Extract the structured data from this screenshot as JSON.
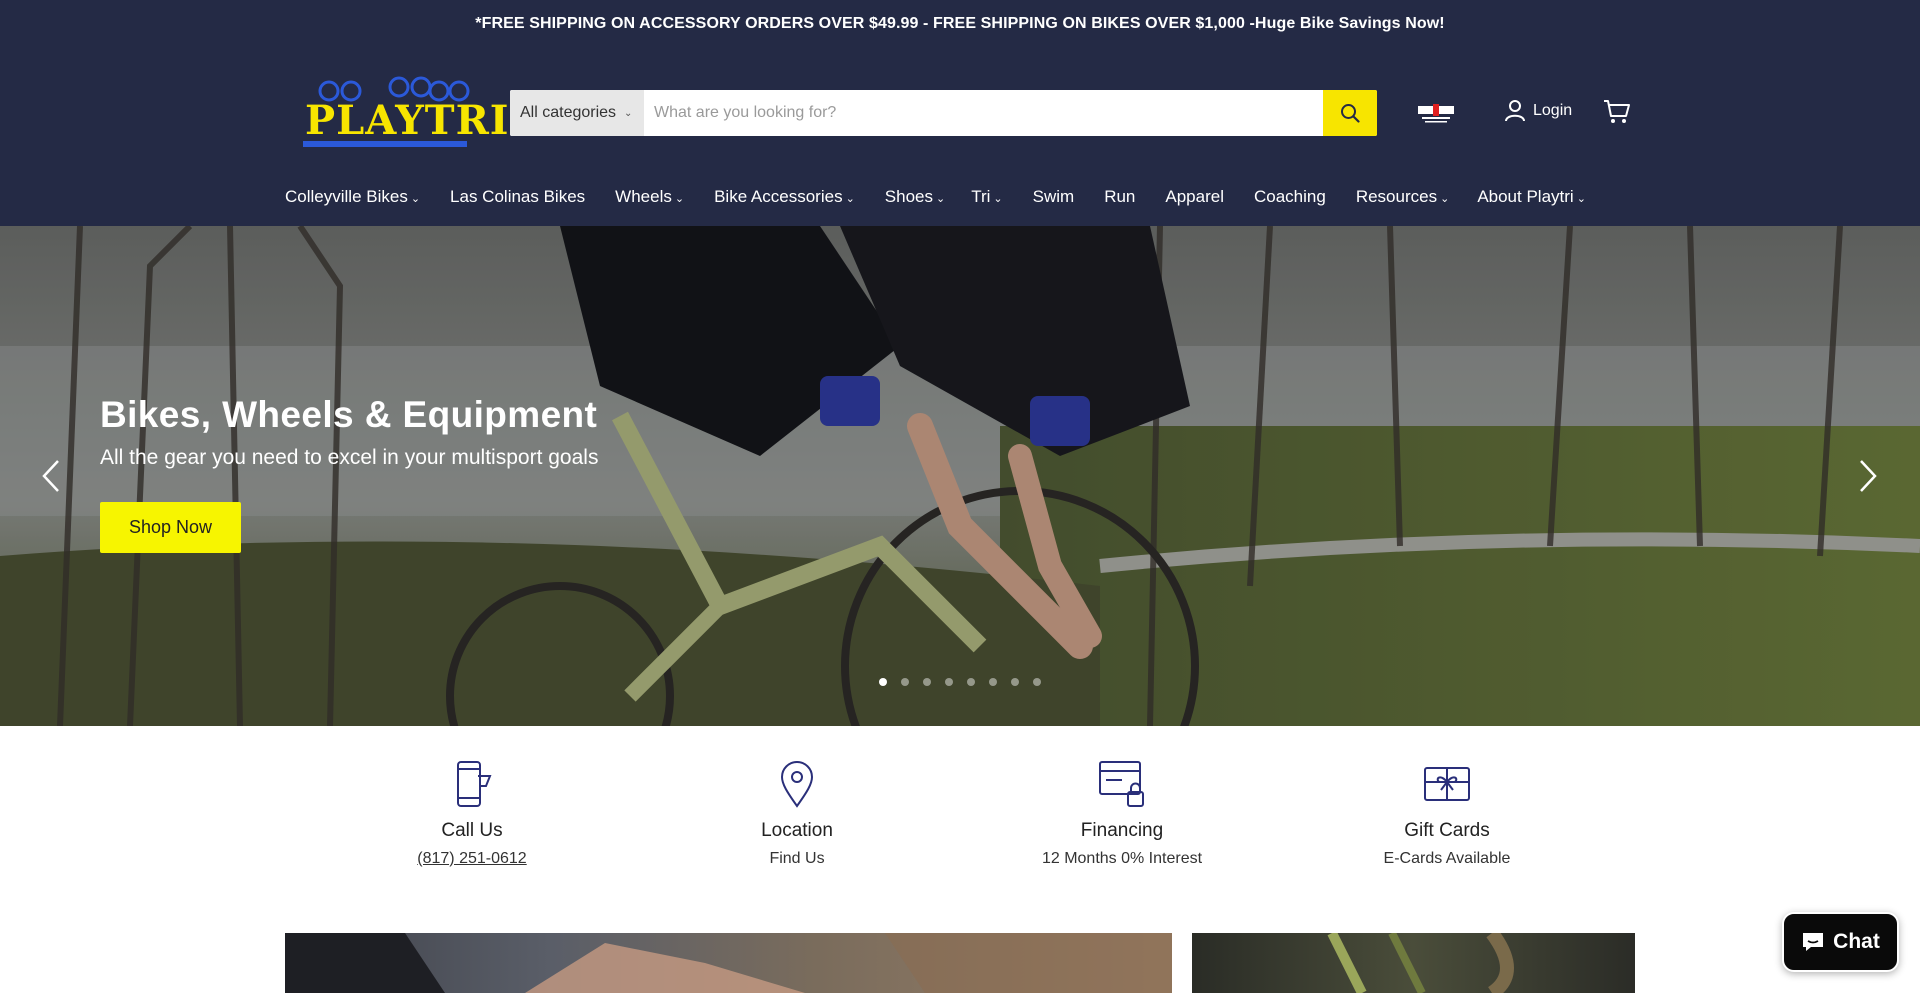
{
  "announcement": "*FREE SHIPPING ON ACCESSORY ORDERS OVER $49.99 - FREE SHIPPING ON BIKES OVER $1,000 -Huge Bike Savings Now!",
  "logo": {
    "text": "PLAYTRI"
  },
  "search": {
    "category": "All categories",
    "placeholder": "What are you looking for?"
  },
  "account": {
    "login_label": "Login"
  },
  "nav": [
    {
      "label": "Colleyville Bikes",
      "dropdown": true
    },
    {
      "label": "Las Colinas Bikes",
      "dropdown": false
    },
    {
      "label": "Wheels",
      "dropdown": true
    },
    {
      "label": "Bike Accessories",
      "dropdown": true
    },
    {
      "label": "Shoes",
      "dropdown": true
    },
    {
      "label": "Tri",
      "dropdown": true
    },
    {
      "label": "Swim",
      "dropdown": false
    },
    {
      "label": "Run",
      "dropdown": false
    },
    {
      "label": "Apparel",
      "dropdown": false
    },
    {
      "label": "Coaching",
      "dropdown": false
    },
    {
      "label": "Resources",
      "dropdown": true
    },
    {
      "label": "About Playtri",
      "dropdown": true
    }
  ],
  "hero": {
    "title": "Bikes, Wheels & Equipment",
    "subtitle": "All the gear you need to excel in your multisport goals",
    "cta": "Shop Now",
    "slide_count": 8,
    "active_slide": 1
  },
  "features": [
    {
      "icon": "phone-icon",
      "title": "Call Us",
      "subtitle": "(817) 251-0612",
      "link": true
    },
    {
      "icon": "location-pin-icon",
      "title": "Location",
      "subtitle": "Find Us",
      "link": false
    },
    {
      "icon": "financing-card-lock-icon",
      "title": "Financing",
      "subtitle": "12 Months 0% Interest",
      "link": false
    },
    {
      "icon": "gift-card-icon",
      "title": "Gift Cards",
      "subtitle": "E-Cards Available",
      "link": false
    }
  ],
  "chat": {
    "label": "Chat"
  },
  "colors": {
    "header_bg": "#242a45",
    "accent_yellow": "#f7e500",
    "icon_blue": "#2a2f7a"
  }
}
